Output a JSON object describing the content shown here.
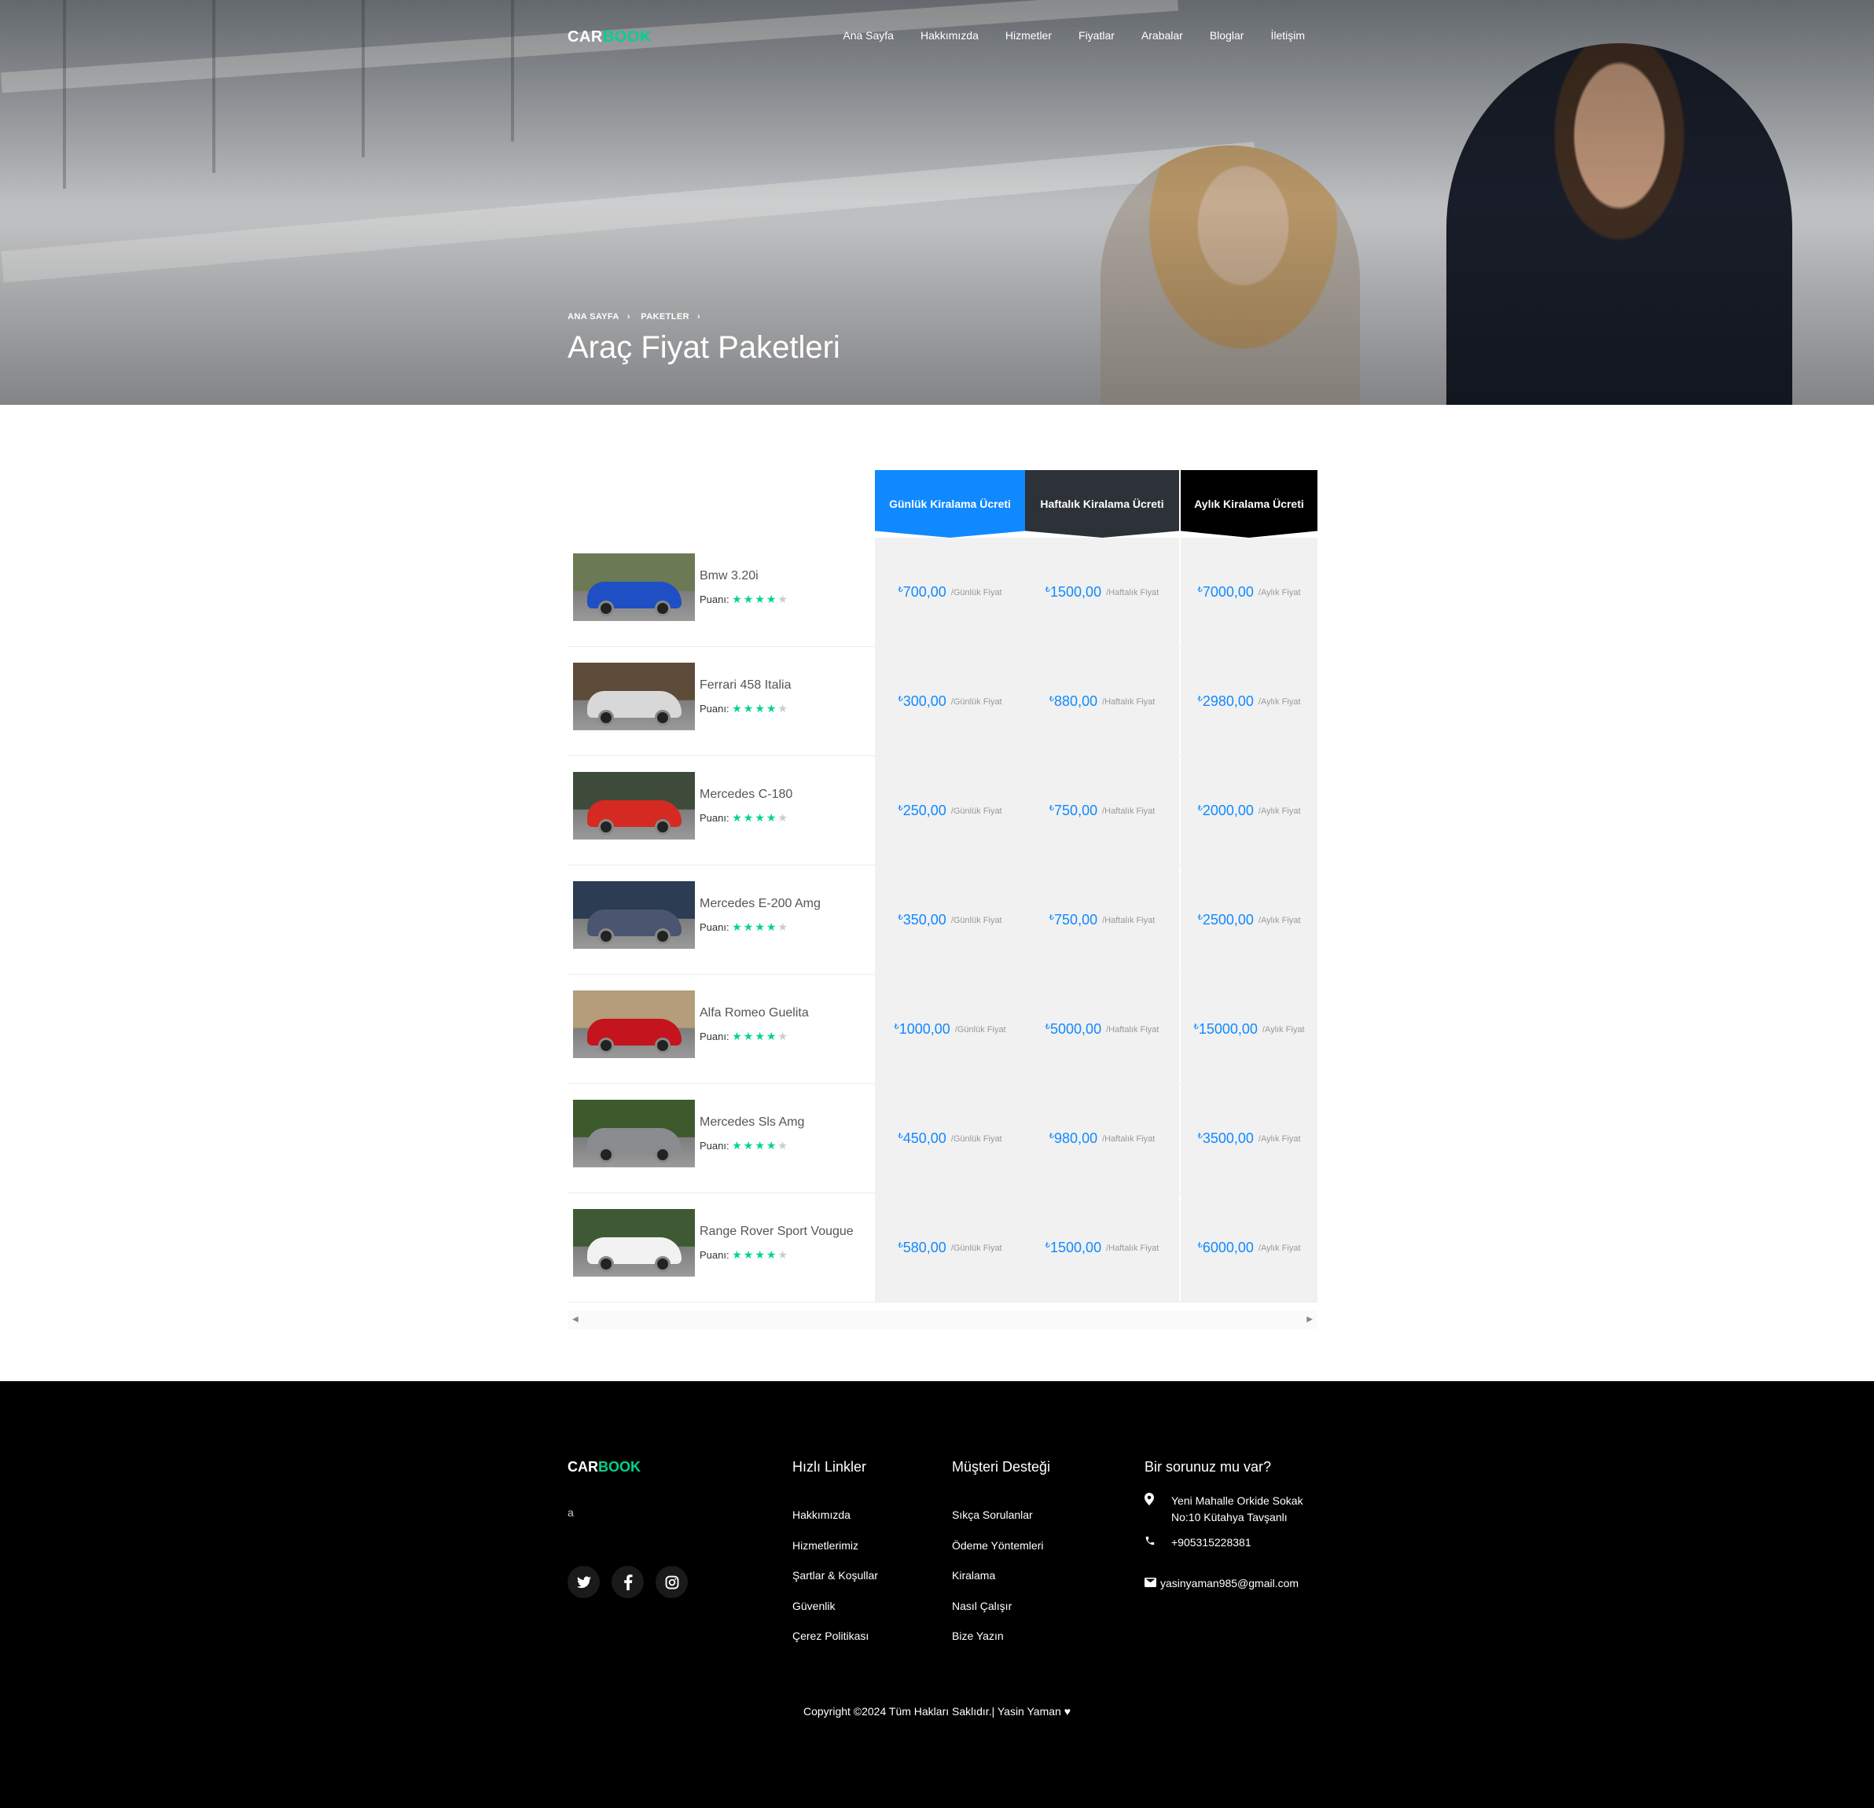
{
  "brand": {
    "part1": "CAR",
    "part2": "BOOK"
  },
  "nav": [
    "Ana Sayfa",
    "Hakkımızda",
    "Hizmetler",
    "Fiyatlar",
    "Arabalar",
    "Bloglar",
    "İletişim"
  ],
  "hero": {
    "breadcrumbs": [
      "ANA SAYFA",
      "PAKETLER"
    ],
    "title": "Araç Fiyat Paketleri"
  },
  "pricing": {
    "headers": [
      "Günlük Kiralama Ücreti",
      "Haftalık Kiralama Ücreti",
      "Aylık Kiralama Ücreti"
    ],
    "currency": "₺",
    "rating_label": "Puanı:",
    "rating_stars": 4,
    "rating_max": 5,
    "per_labels": [
      "/Günlük Fiyat",
      "/Haftalık Fiyat",
      "/Aylık Fiyat"
    ],
    "cars": [
      {
        "name": "Bmw 3.20i",
        "daily": "700,00",
        "weekly": "1500,00",
        "monthly": "7000,00",
        "color": "#1f4fc4",
        "bg": "#6b7a55"
      },
      {
        "name": "Ferrari 458 Italia",
        "daily": "300,00",
        "weekly": "880,00",
        "monthly": "2980,00",
        "color": "#d8d8d8",
        "bg": "#5d4b3a"
      },
      {
        "name": "Mercedes C-180",
        "daily": "250,00",
        "weekly": "750,00",
        "monthly": "2000,00",
        "color": "#d42a22",
        "bg": "#3e4b3a"
      },
      {
        "name": "Mercedes E-200 Amg",
        "daily": "350,00",
        "weekly": "750,00",
        "monthly": "2500,00",
        "color": "#4a5670",
        "bg": "#2c3c52"
      },
      {
        "name": "Alfa Romeo Guelita",
        "daily": "1000,00",
        "weekly": "5000,00",
        "monthly": "15000,00",
        "color": "#c4141e",
        "bg": "#b59c7a"
      },
      {
        "name": "Mercedes Sls Amg",
        "daily": "450,00",
        "weekly": "980,00",
        "monthly": "3500,00",
        "color": "#8a8c90",
        "bg": "#3d5a2c"
      },
      {
        "name": "Range Rover Sport Vougue",
        "daily": "580,00",
        "weekly": "1500,00",
        "monthly": "6000,00",
        "color": "#f2f2f2",
        "bg": "#3e5a35"
      }
    ]
  },
  "footer": {
    "description": "a",
    "social": [
      "twitter-icon",
      "facebook-icon",
      "instagram-icon"
    ],
    "quick_links_title": "Hızlı Linkler",
    "quick_links": [
      "Hakkımızda",
      "Hizmetlerimiz",
      "Şartlar & Koşullar",
      "Güvenlik",
      "Çerez Politikası"
    ],
    "support_title": "Müşteri Desteği",
    "support_links": [
      "Sıkça Sorulanlar",
      "Ödeme Yöntemleri",
      "Kiralama",
      "Nasıl Çalışır",
      "Bize Yazın"
    ],
    "help_title": "Bir sorunuz mu var?",
    "address": "Yeni Mahalle Orkide Sokak No:10 Kütahya Tavşanlı",
    "phone": "+905315228381",
    "email": "yasinyaman985@gmail.com",
    "copyright": "Copyright ©2024 Tüm Hakları Saklıdır.| Yasin Yaman ♥"
  }
}
